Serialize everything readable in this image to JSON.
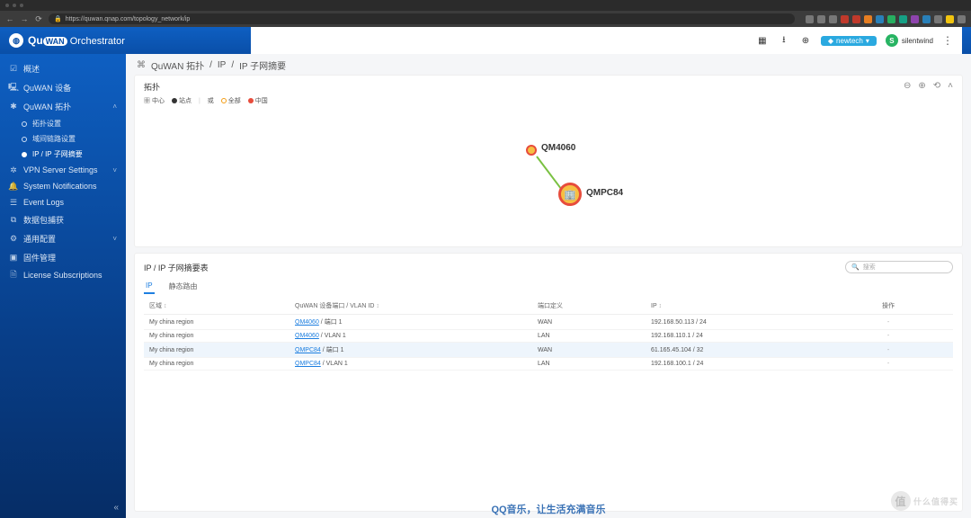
{
  "browser": {
    "url": "https://quwan.qnap.com/topology_network/ip"
  },
  "brand": {
    "q": "Qu",
    "wan": "WAN",
    "product": "Orchestrator"
  },
  "header": {
    "chip_label": "newtech",
    "avatar_initial": "S",
    "username": "silentwind"
  },
  "sidebar": {
    "items": [
      {
        "icon": "dashboard-icon",
        "label": "概述"
      },
      {
        "icon": "device-icon",
        "label": "QuWAN 设备"
      },
      {
        "icon": "topology-icon",
        "label": "QuWAN 拓扑"
      },
      {
        "icon": "vpn-icon",
        "label": "VPN Server Settings"
      },
      {
        "icon": "bell-icon",
        "label": "System Notifications"
      },
      {
        "icon": "log-icon",
        "label": "Event Logs"
      },
      {
        "icon": "capture-icon",
        "label": "数据包捕获"
      },
      {
        "icon": "gear-icon",
        "label": "通用配置"
      },
      {
        "icon": "firmware-icon",
        "label": "固件管理"
      },
      {
        "icon": "license-icon",
        "label": "License Subscriptions"
      }
    ],
    "qu_topo_subs": [
      {
        "label": "拓扑设置"
      },
      {
        "label": "域间链路设置"
      },
      {
        "label": "IP / IP 子网摘要"
      }
    ]
  },
  "breadcrumb": {
    "root": "QuWAN 拓扑",
    "mid": "IP",
    "leaf": "IP 子网摘要"
  },
  "topo": {
    "title": "拓扑",
    "legend": {
      "center": "中心",
      "site": "站点",
      "or": "或",
      "all": "全部",
      "china": "中国"
    },
    "nodes": {
      "small": "QM4060",
      "large": "QMPC84"
    }
  },
  "table": {
    "title": "IP / IP 子网摘要表",
    "search_placeholder": "搜索",
    "tabs": {
      "ip": "IP",
      "static": "静态路由"
    },
    "columns": {
      "region": "区域",
      "device": "QuWAN 设备端口 / VLAN ID",
      "portdef": "端口定义",
      "ip": "IP",
      "action": "操作"
    },
    "sort_glyph": "↕",
    "rows": [
      {
        "region": "My china region",
        "device": "QM4060",
        "port": "端口 1",
        "def": "WAN",
        "ip": "192.168.50.113 / 24",
        "action": "-"
      },
      {
        "region": "My china region",
        "device": "QM4060",
        "port": "VLAN 1",
        "def": "LAN",
        "ip": "192.168.110.1 / 24",
        "action": "-"
      },
      {
        "region": "My china region",
        "device": "QMPC84",
        "port": "端口 1",
        "def": "WAN",
        "ip": "61.165.45.104 / 32",
        "action": "-",
        "hi": true
      },
      {
        "region": "My china region",
        "device": "QMPC84",
        "port": "VLAN 1",
        "def": "LAN",
        "ip": "192.168.100.1 / 24",
        "action": "-"
      }
    ]
  },
  "footer": {
    "ad": "QQ音乐，让生活充满音乐",
    "watermark": "什么值得买"
  }
}
